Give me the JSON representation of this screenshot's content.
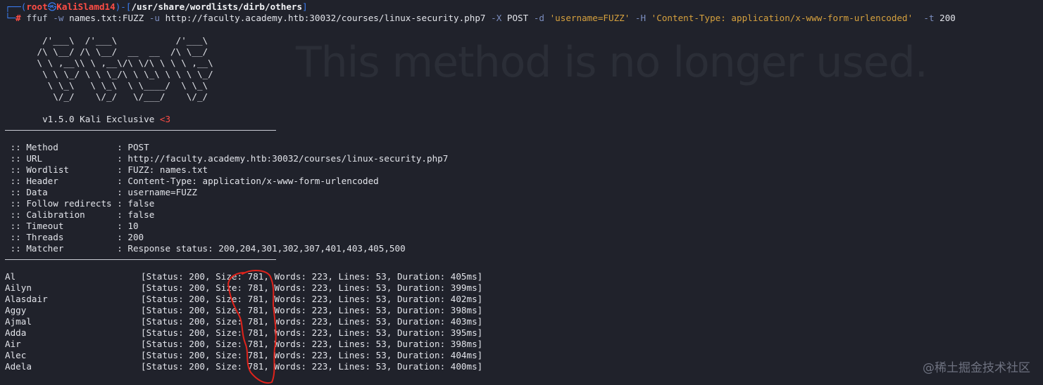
{
  "prompt": {
    "corner_top": "┌──(",
    "user": "root",
    "at": "㉿",
    "host": "KaliSlamd14",
    "mid": ")-[",
    "path": "/usr/share/wordlists/dirb/others",
    "close": "]",
    "corner_bottom": "└─",
    "hash": "#"
  },
  "command": {
    "program": "ffuf",
    "w_flag": "-w",
    "w_val": "names.txt:FUZZ",
    "u_flag": "-u",
    "u_val": "http://faculty.academy.htb:30032/courses/linux-security.php7",
    "x_flag": "-X",
    "x_val": "POST",
    "d_flag": "-d",
    "d_val": "'username=FUZZ'",
    "h_flag": "-H",
    "h_val": "'Content-Type: application/x-www-form-urlencoded'",
    "t_flag": "-t",
    "t_val": "200"
  },
  "ghost_text": "This method is no longer used.",
  "banner": [
    "       /'___\\  /'___\\           /'___\\       ",
    "      /\\ \\__/ /\\ \\__/  __  __  /\\ \\__/       ",
    "      \\ \\ ,__\\\\ \\ ,__\\/\\ \\/\\ \\ \\ \\ ,__\\      ",
    "       \\ \\ \\_/ \\ \\ \\_/\\ \\ \\_\\ \\ \\ \\ \\_/      ",
    "        \\ \\_\\   \\ \\_\\  \\ \\____/  \\ \\_\\       ",
    "         \\/_/    \\/_/   \\/___/    \\/_/       "
  ],
  "version": "       v1.5.0 Kali Exclusive ",
  "version_heart": "<3",
  "config": [
    " :: Method           : POST",
    " :: URL              : http://faculty.academy.htb:30032/courses/linux-security.php7",
    " :: Wordlist         : FUZZ: names.txt",
    " :: Header           : Content-Type: application/x-www-form-urlencoded",
    " :: Data             : username=FUZZ",
    " :: Follow redirects : false",
    " :: Calibration      : false",
    " :: Timeout          : 10",
    " :: Threads          : 200",
    " :: Matcher          : Response status: 200,204,301,302,307,401,403,405,500"
  ],
  "results": [
    {
      "word": "Al",
      "info": "[Status: 200, Size: 781, Words: 223, Lines: 53, Duration: 405ms]"
    },
    {
      "word": "Ailyn",
      "info": "[Status: 200, Size: 781, Words: 223, Lines: 53, Duration: 399ms]"
    },
    {
      "word": "Alasdair",
      "info": "[Status: 200, Size: 781, Words: 223, Lines: 53, Duration: 402ms]"
    },
    {
      "word": "Aggy",
      "info": "[Status: 200, Size: 781, Words: 223, Lines: 53, Duration: 398ms]"
    },
    {
      "word": "Ajmal",
      "info": "[Status: 200, Size: 781, Words: 223, Lines: 53, Duration: 403ms]"
    },
    {
      "word": "Adda",
      "info": "[Status: 200, Size: 781, Words: 223, Lines: 53, Duration: 395ms]"
    },
    {
      "word": "Air",
      "info": "[Status: 200, Size: 781, Words: 223, Lines: 53, Duration: 398ms]"
    },
    {
      "word": "Alec",
      "info": "[Status: 200, Size: 781, Words: 223, Lines: 53, Duration: 404ms]"
    },
    {
      "word": "Adela",
      "info": "[Status: 200, Size: 781, Words: 223, Lines: 53, Duration: 400ms]"
    }
  ],
  "watermark": "@稀土掘金技术社区",
  "annotation": {
    "shape": "hand-drawn-circle",
    "color": "#e0231b",
    "highlights": "Size: 781"
  }
}
